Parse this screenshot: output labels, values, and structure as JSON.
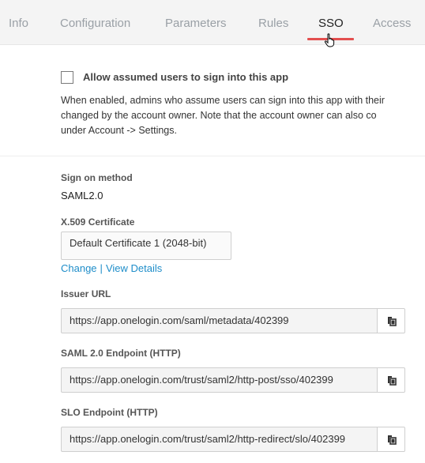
{
  "tabs": [
    {
      "label": "Info"
    },
    {
      "label": "Configuration"
    },
    {
      "label": "Parameters"
    },
    {
      "label": "Rules"
    },
    {
      "label": "SSO"
    },
    {
      "label": "Access"
    }
  ],
  "assume": {
    "label": "Allow assumed users to sign into this app",
    "checked": false,
    "help_line1": "When enabled, admins who assume users can sign into this app with their",
    "help_line2": "changed by the account owner. Note that the account owner can also co",
    "help_line3": "under Account -> Settings."
  },
  "sign_on": {
    "label": "Sign on method",
    "value": "SAML2.0"
  },
  "certificate": {
    "label": "X.509 Certificate",
    "value": "Default Certificate 1 (2048-bit)",
    "change_link": "Change",
    "separator": "|",
    "view_link": "View Details"
  },
  "issuer": {
    "label": "Issuer URL",
    "value": "https://app.onelogin.com/saml/metadata/402399"
  },
  "saml_endpoint": {
    "label": "SAML 2.0 Endpoint (HTTP)",
    "value": "https://app.onelogin.com/trust/saml2/http-post/sso/402399"
  },
  "slo_endpoint": {
    "label": "SLO Endpoint (HTTP)",
    "value": "https://app.onelogin.com/trust/saml2/http-redirect/slo/402399"
  },
  "colors": {
    "accent_underline": "#e34f4f",
    "link": "#1e8dc9"
  },
  "icons": {
    "copy": "copy-icon",
    "cursor": "hand-pointer-icon"
  }
}
